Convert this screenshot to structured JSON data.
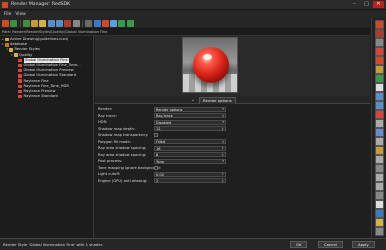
{
  "window": {
    "title": "Render Manager: RedSDK",
    "min": "–",
    "max": "□",
    "close": "✕"
  },
  "menu": [
    "File",
    "View"
  ],
  "toolbar": {
    "icons": [
      "back-arrow-icon",
      "forward-arrow-icon",
      "up-folder-icon",
      "new-folder-icon",
      "new-item-icon",
      "copy-icon",
      "paste-icon",
      "delete-icon",
      "rename-icon",
      "properties-icon",
      "library-icon",
      "render-icon",
      "gear-icon",
      "play-icon",
      "play-alt-icon"
    ]
  },
  "path": "Path: Render\\RenderStyles\\Quality\\Global illumination Fine",
  "tree": [
    {
      "label": "Active Drawing(guidelines.iczd)",
      "indent": 0,
      "icon": "drawing-icon",
      "color": "#d9a23a",
      "expander": "▸"
    },
    {
      "label": "database",
      "indent": 0,
      "icon": "database-icon",
      "color": "#c07a32",
      "expander": "▾"
    },
    {
      "label": "Render Styles",
      "indent": 1,
      "icon": "folder-icon",
      "color": "#d2b04c",
      "expander": "▾"
    },
    {
      "label": "Quality",
      "indent": 2,
      "icon": "folder-icon",
      "color": "#d2b04c",
      "expander": "▾"
    },
    {
      "label": "Global illumination Fine",
      "indent": 3,
      "icon": "render-style-icon",
      "color": "#d8463a",
      "expander": "",
      "selected": true
    },
    {
      "label": "Global illumination Fine_Tone...",
      "indent": 3,
      "icon": "render-style-icon",
      "color": "#d8463a",
      "expander": ""
    },
    {
      "label": "Global illumination Preview",
      "indent": 3,
      "icon": "render-style-icon",
      "color": "#d8463a",
      "expander": ""
    },
    {
      "label": "Global illumination Standard",
      "indent": 3,
      "icon": "render-style-icon",
      "color": "#d8463a",
      "expander": ""
    },
    {
      "label": "Raytrace Fine",
      "indent": 3,
      "icon": "render-style-icon",
      "color": "#d8463a",
      "expander": ""
    },
    {
      "label": "Raytrace Fine_Tone_HDR",
      "indent": 3,
      "icon": "render-style-icon",
      "color": "#d8463a",
      "expander": ""
    },
    {
      "label": "Raytrace Preview",
      "indent": 3,
      "icon": "render-style-icon",
      "color": "#d8463a",
      "expander": ""
    },
    {
      "label": "Raytrace Standard",
      "indent": 3,
      "icon": "render-style-icon",
      "color": "#d8463a",
      "expander": ""
    }
  ],
  "tabs": {
    "active": "Render options",
    "arrow": "◂"
  },
  "options": [
    {
      "label": "Render:",
      "value": "Render options",
      "kind": "dropdown"
    },
    {
      "label": "Ray trace:",
      "value": "Ray trace",
      "kind": "dropdown"
    },
    {
      "label": "HDR:",
      "value": "Disabled",
      "kind": "dropdown"
    },
    {
      "label": "Shadow map depth:",
      "value": "12",
      "kind": "spin"
    },
    {
      "label": "Shadow map transparency:",
      "value": "",
      "kind": "checkbox"
    },
    {
      "label": "Polygon fill mode:",
      "value": "Filled",
      "kind": "dropdown"
    },
    {
      "label": "Ray area shadow spacing:",
      "value": "16",
      "kind": "spin"
    },
    {
      "label": "Ray area shadow spacing:",
      "value": "8",
      "kind": "spin"
    },
    {
      "label": "Post process:",
      "value": "Tone",
      "kind": "dropdown"
    },
    {
      "label": "Tone mapping ignore background:",
      "value": "",
      "kind": "checkbox"
    },
    {
      "label": "Light cutoff:",
      "value": "0.00",
      "kind": "spin"
    },
    {
      "label": "Engine (GPU) anti aliasing:",
      "value": "2",
      "kind": "spin"
    }
  ],
  "right_toolbar": [
    "add-icon",
    "delete-icon",
    "rename-icon",
    "material-icon",
    "render-icon",
    "active-icon",
    "apply-icon",
    "cursor-icon",
    "link-icon",
    "unlink-icon",
    "sphere-icon",
    "ruler-icon",
    "image-icon",
    "frame-icon",
    "layers-icon",
    "crop-icon",
    "grid-icon",
    "list-icon",
    "align-icon",
    "settings-icon",
    "text-icon",
    "library-icon",
    "folder-icon",
    "options-icon"
  ],
  "status": {
    "text": "Render Style 'Global illumination Fine' with 1 shader.",
    "ok": "OK",
    "cancel": "Cancel",
    "apply": "Apply"
  }
}
